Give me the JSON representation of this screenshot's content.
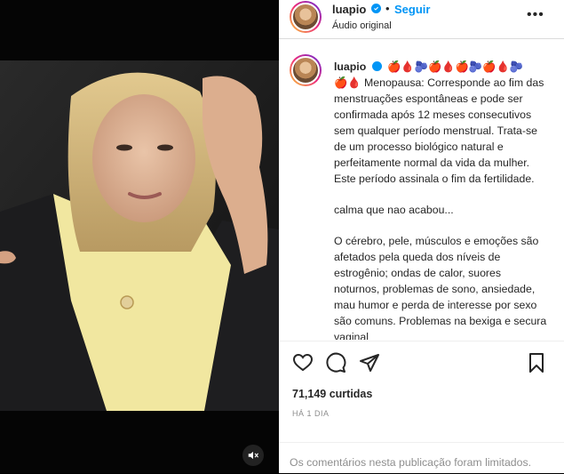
{
  "post": {
    "username": "luapio",
    "follow_label": "Seguir",
    "audio_label": "Áudio original",
    "more_label": "•••"
  },
  "caption": {
    "username": "luapio",
    "emoji_line": "🍎🩸🫐🍎🩸🍎🫐🍎🩸🫐",
    "paragraphs": [
      "🍎🩸 Menopausa: Corresponde ao fim das menstruações espontâneas e pode ser confirmada após 12 meses consecutivos sem qualquer período menstrual. Trata-se de um processo biológico natural e perfeitamente normal da vida da mulher. Este período assinala o fim da fertilidade.",
      "calma que nao acabou...",
      "O cérebro, pele, músculos e emoções são afetados pela queda dos níveis de estrogênio; ondas de calor, suores noturnos, problemas de sono, ansiedade, mau humor e perda de interesse por sexo são comuns. Problemas na bexiga e secura vaginal"
    ]
  },
  "stats": {
    "likes": "71,149 curtidas",
    "time": "HÁ 1 DIA"
  },
  "footer": {
    "comments_limited": "Os comentários nesta publicação foram limitados."
  },
  "icons": {
    "like": "heart-icon",
    "comment": "comment-icon",
    "share": "send-icon",
    "save": "bookmark-icon",
    "mute": "speaker-muted-icon",
    "verified": "verified-badge-icon"
  },
  "colors": {
    "link": "#0095f6",
    "text": "#262626",
    "muted": "#8e8e8e"
  }
}
